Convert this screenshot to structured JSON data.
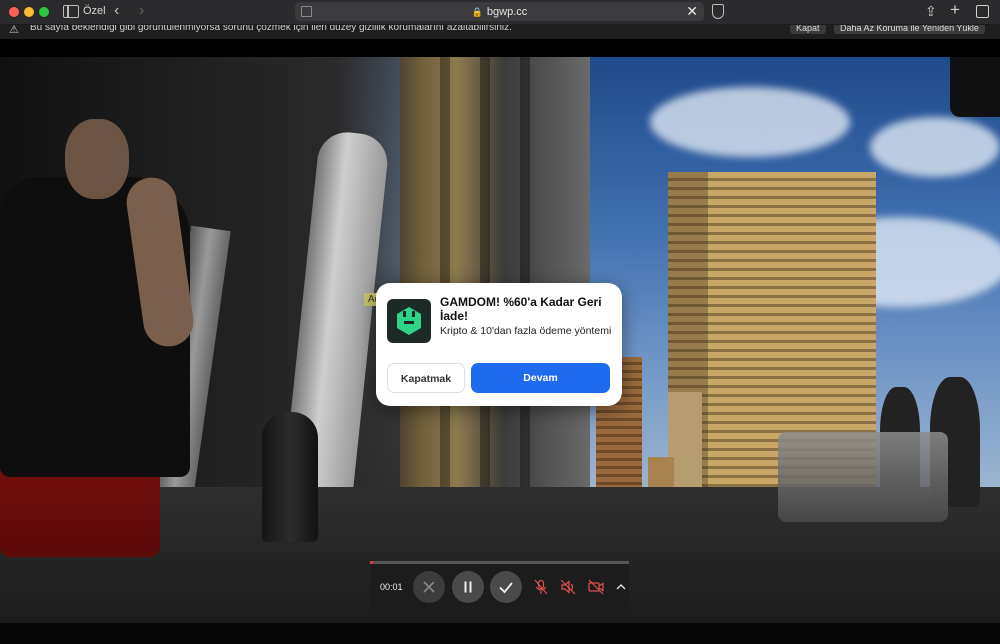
{
  "browser": {
    "private_label": "Özel",
    "url": "bgwp.cc"
  },
  "warning_bar": {
    "text": "Bu sayfa beklendiği gibi görüntülenmiyorsa sorunu çözmek için ileri düzey gizlilik korumalarını azaltabilirsiniz.",
    "close_label": "Kapat",
    "reload_label": "Daha Az Koruma ile Yeniden Yükle"
  },
  "ad": {
    "tag": "Ad",
    "title": "GAMDOM! %60'a Kadar Geri İade!",
    "description": "Kripto & 10'dan fazla ödeme yöntemi",
    "close_label": "Kapatmak",
    "continue_label": "Devam",
    "continue_color": "#1f6bf0",
    "logo_color": "#2fd389"
  },
  "player": {
    "time": "00:01",
    "progress": 0.01,
    "progress_color": "#e53935",
    "icons": [
      "cancel-icon",
      "pause-icon",
      "check-icon",
      "mic-muted-icon",
      "speaker-muted-icon",
      "camera-off-icon",
      "chevron-up-icon"
    ]
  }
}
